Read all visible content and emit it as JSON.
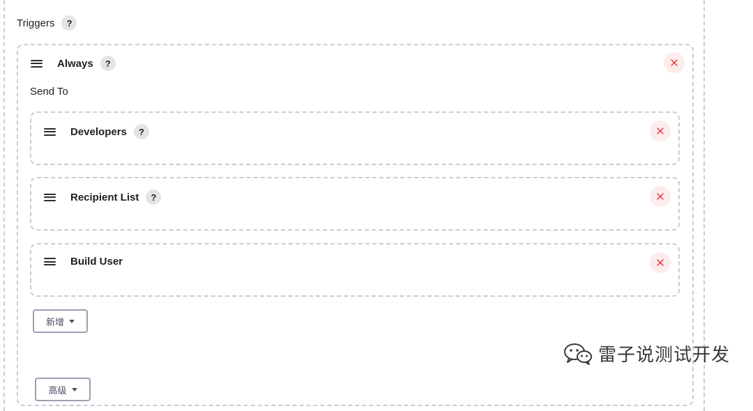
{
  "triggers": {
    "label": "Triggers",
    "help": "?"
  },
  "trigger": {
    "title": "Always",
    "help": "?",
    "send_to_label": "Send To",
    "recipients": [
      {
        "title": "Developers",
        "help": "?"
      },
      {
        "title": "Recipient List",
        "help": "?"
      },
      {
        "title": "Build User"
      }
    ],
    "add_button_label": "新增"
  },
  "bottom_button_label": "高级",
  "watermark_text": "雷子说测试开发",
  "icons": {
    "drag": "drag-handle-icon",
    "close": "close-icon",
    "help": "help-icon",
    "caret": "caret-down-icon",
    "wechat": "wechat-logo-icon"
  },
  "colors": {
    "close_bg": "#fdecec",
    "close_x": "#e0303a",
    "dash_border": "#c9ccd4",
    "button_border": "#9aa0b1"
  }
}
